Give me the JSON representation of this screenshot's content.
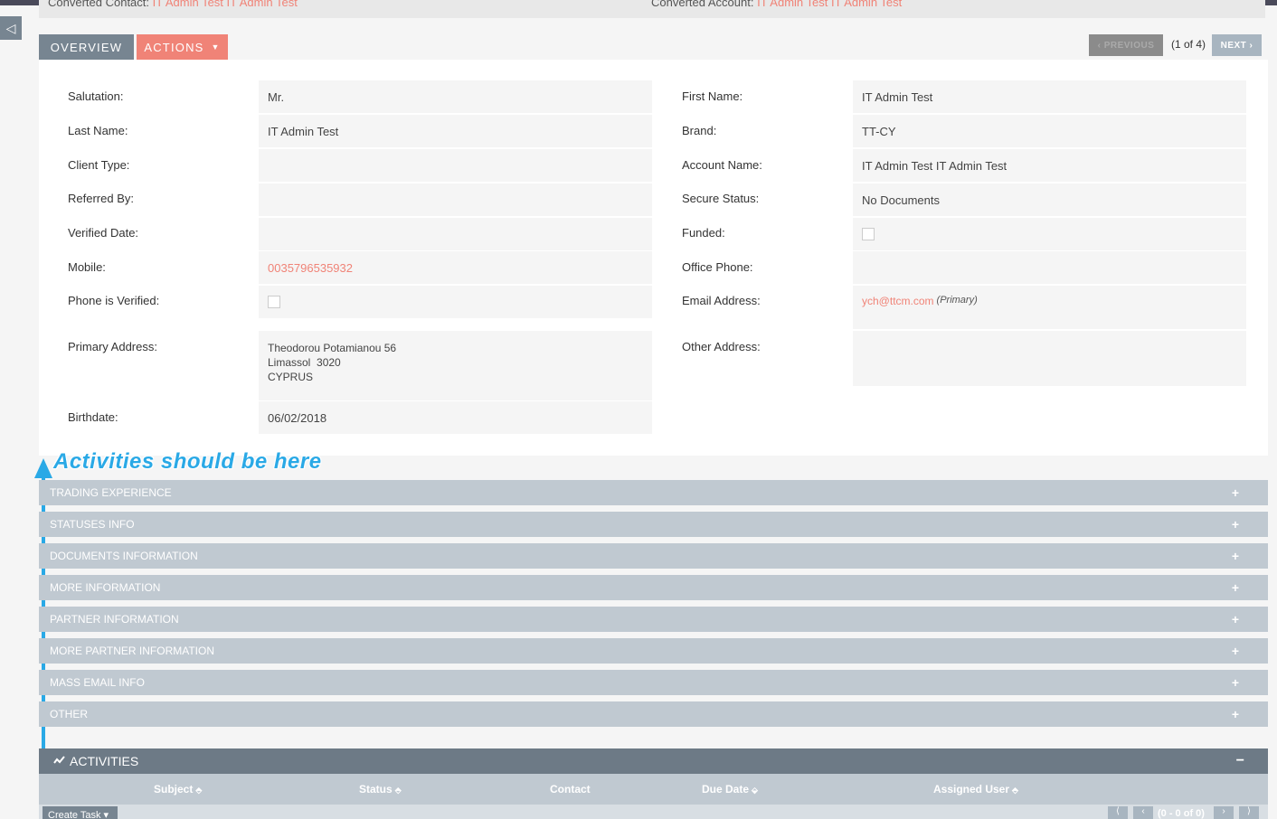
{
  "header": {
    "converted_contact_label": "Converted Contact:",
    "converted_contact_value": "IT Admin Test IT Admin Test",
    "converted_account_label": "Converted Account:",
    "converted_account_value": "IT Admin Test IT Admin Test",
    "sidebar_toggle": "◁"
  },
  "tabs": {
    "overview": "OVERVIEW",
    "actions": "ACTIONS",
    "actions_caret": "▼"
  },
  "pagination": {
    "previous": "‹ PREVIOUS",
    "count": "(1 of 4)",
    "next": "NEXT ›"
  },
  "fields": {
    "salutation": {
      "label": "Salutation:",
      "value": "Mr."
    },
    "last_name": {
      "label": "Last Name:",
      "value": "IT Admin Test"
    },
    "client_type": {
      "label": "Client Type:",
      "value": ""
    },
    "referred_by": {
      "label": "Referred By:",
      "value": ""
    },
    "verified_date": {
      "label": "Verified Date:",
      "value": ""
    },
    "mobile": {
      "label": "Mobile:",
      "value": "0035796535932"
    },
    "phone_verified": {
      "label": "Phone is Verified:",
      "checked": false
    },
    "primary_address": {
      "label": "Primary Address:",
      "line1": "Theodorou Potamianou 56",
      "line2": "Limassol  3020",
      "line3": "CYPRUS"
    },
    "birthdate": {
      "label": "Birthdate:",
      "value": "06/02/2018"
    },
    "first_name": {
      "label": "First Name:",
      "value": "IT Admin Test"
    },
    "brand": {
      "label": "Brand:",
      "value": "TT-CY"
    },
    "account_name": {
      "label": "Account Name:",
      "value": "IT Admin Test IT Admin Test"
    },
    "secure_status": {
      "label": "Secure Status:",
      "value": "No Documents"
    },
    "funded": {
      "label": "Funded:",
      "checked": false
    },
    "office_phone": {
      "label": "Office Phone:",
      "value": ""
    },
    "email_address": {
      "label": "Email Address:",
      "value": "ych@ttcm.com",
      "tag": "(Primary)"
    },
    "other_address": {
      "label": "Other Address:",
      "value": ""
    }
  },
  "annotation": "Activities should  be here",
  "sections": [
    "TRADING EXPERIENCE",
    "STATUSES INFO",
    "DOCUMENTS INFORMATION",
    "MORE INFORMATION",
    "PARTNER INFORMATION",
    "MORE PARTNER INFORMATION",
    "MASS EMAIL INFO",
    "OTHER"
  ],
  "section_expand": "+",
  "activities": {
    "title": "ACTIVITIES",
    "collapse": "−",
    "columns": [
      "Subject",
      "Status",
      "Contact",
      "Due Date",
      "Assigned User"
    ],
    "create_task": "Create Task ▾",
    "count": "(0 - 0 of 0)"
  },
  "colors": {
    "accent": "#f08377",
    "tab_gray": "#778591",
    "section_bar": "#c0c9d1",
    "annotation": "#2aa9e6"
  }
}
